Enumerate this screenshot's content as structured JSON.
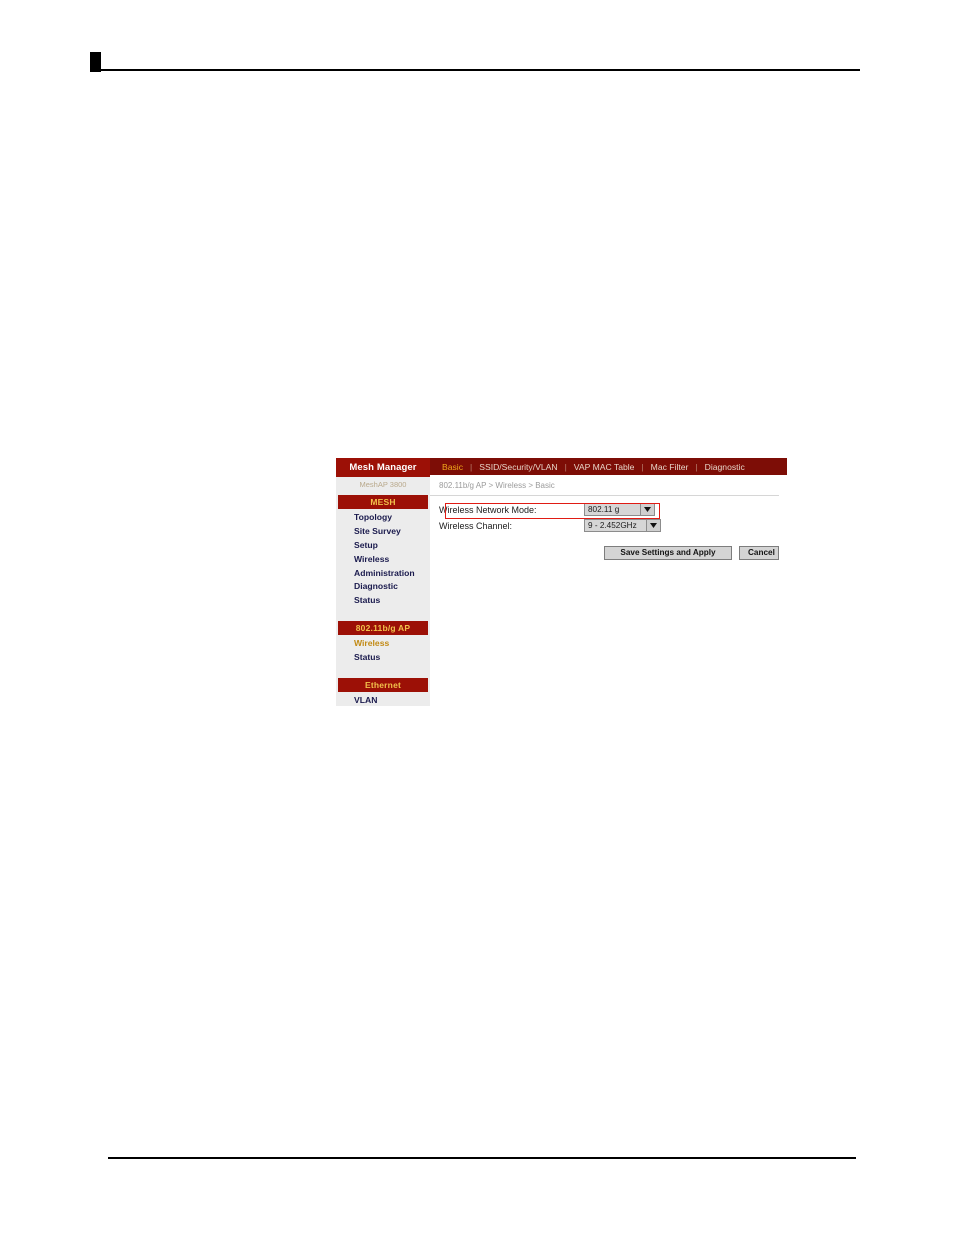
{
  "document_page": {
    "header": {
      "marker": "black-square-tab",
      "rule": true
    },
    "footer": {
      "rule": true
    }
  },
  "screenshot": {
    "sidebar": {
      "brand": "Mesh Manager",
      "model": "MeshAP 3800",
      "sections": [
        {
          "heading": "MESH",
          "items": [
            {
              "label": "Topology",
              "active": false
            },
            {
              "label": "Site Survey",
              "active": false
            },
            {
              "label": "Setup",
              "active": false
            },
            {
              "label": "Wireless",
              "active": false
            },
            {
              "label": "Administration",
              "active": false
            },
            {
              "label": "Diagnostic",
              "active": false
            },
            {
              "label": "Status",
              "active": false
            }
          ]
        },
        {
          "heading": "802.11b/g AP",
          "items": [
            {
              "label": "Wireless",
              "active": true
            },
            {
              "label": "Status",
              "active": false
            }
          ]
        },
        {
          "heading": "Ethernet",
          "items": [
            {
              "label": "VLAN",
              "active": false
            }
          ]
        }
      ]
    },
    "tabs": [
      {
        "label": "Basic",
        "active": true
      },
      {
        "label": "SSID/Security/VLAN",
        "active": false
      },
      {
        "label": "VAP MAC Table",
        "active": false
      },
      {
        "label": "Mac Filter",
        "active": false
      },
      {
        "label": "Diagnostic",
        "active": false
      }
    ],
    "tab_separator": "|",
    "breadcrumb": "802.11b/g AP > Wireless > Basic",
    "form": {
      "rows": [
        {
          "label": "Wireless Network Mode:",
          "value": "802.11 g",
          "highlighted": true
        },
        {
          "label": "Wireless Channel:",
          "value": "9 - 2.452GHz",
          "highlighted": false
        }
      ]
    },
    "buttons": {
      "save": "Save Settings and Apply",
      "cancel": "Cancel"
    },
    "colors": {
      "brand_red": "#9c1006",
      "tabbar_red": "#7d0d06",
      "accent_gold": "#f0a81c",
      "sidebar_bg": "#ececec",
      "highlight_red": "#e01b14"
    }
  }
}
